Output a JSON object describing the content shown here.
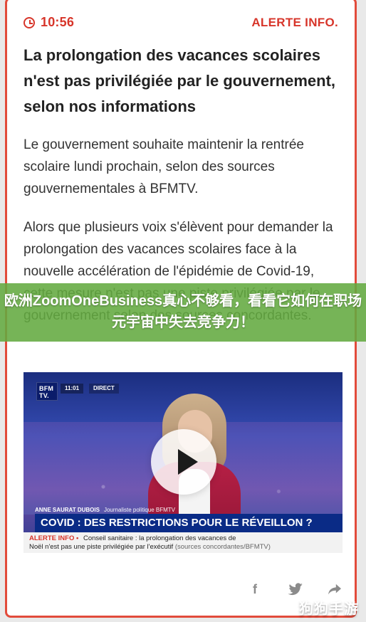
{
  "colors": {
    "accent_red": "#d7352a",
    "border_red": "#e24b3b",
    "banner_green": "#63aa40",
    "ticker_blue": "#0a2b86",
    "share_grey": "#8b8b8b"
  },
  "article": {
    "time": "10:56",
    "brand": "ALERTE INFO.",
    "headline": "La prolongation des vacances scolaires n'est pas privilégiée par le gouvernement, selon nos informations",
    "paragraphs": [
      "Le gouvernement souhaite maintenir la rentrée scolaire lundi prochain, selon des sources gouvernementales à BFMTV.",
      "Alors que plusieurs voix s'élèvent pour demander la prolongation des vacances scolaires face à la nouvelle accélération de l'épidémie de Covid-19, cette mesure n'est pas une piste privilégiée par le gouvernement selon des sources concordantes."
    ]
  },
  "overlay_banner": {
    "text": "欧洲ZoomOneBusiness真心不够看，看看它如何在职场元宇宙中失去竞争力！"
  },
  "video": {
    "logo": "BFM TV.",
    "top_time": "11:01",
    "top_live": "DIRECT",
    "lower_name": "ANNE SAURAT DUBOIS",
    "lower_role": "Journaliste politique BFMTV",
    "headline": "COVID : DES RESTRICTIONS POUR LE RÉVEILLON ?",
    "ticker_label": "ALERTE INFO •",
    "ticker_text_1": "Conseil sanitaire : la prolongation des vacances de",
    "ticker_text_2": "Noël n'est pas une piste privilégiée par l'exécutif",
    "ticker_source": "(sources concordantes/BFMTV)",
    "play_icon": "play-icon"
  },
  "share": {
    "facebook": "f",
    "twitter_icon": "twitter-icon",
    "share_icon": "share-arrow-icon"
  },
  "watermark": "狗狗手游"
}
